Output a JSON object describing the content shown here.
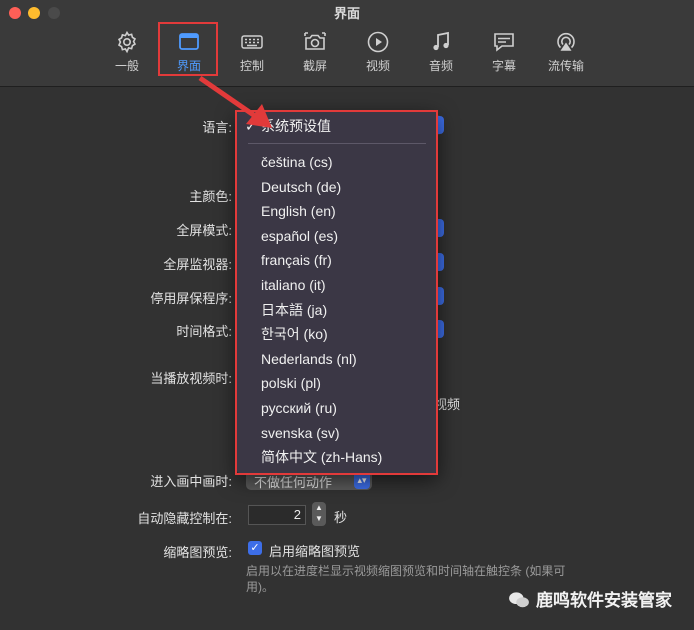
{
  "window": {
    "title": "界面"
  },
  "toolbar": {
    "items": [
      {
        "label": "一般",
        "icon": "gear-icon"
      },
      {
        "label": "界面",
        "icon": "window-icon",
        "selected": true
      },
      {
        "label": "控制",
        "icon": "keyboard-icon"
      },
      {
        "label": "截屏",
        "icon": "camera-icon"
      },
      {
        "label": "视频",
        "icon": "play-icon"
      },
      {
        "label": "音频",
        "icon": "music-note-icon"
      },
      {
        "label": "字幕",
        "icon": "subtitle-icon"
      },
      {
        "label": "流传输",
        "icon": "airplay-icon"
      }
    ]
  },
  "form": {
    "language_label": "语言:",
    "theme_color_label": "主颜色:",
    "fullscreen_mode_label": "全屏模式:",
    "fullscreen_monitor_label": "全屏监视器:",
    "disable_screensaver_label": "停用屏保程序:",
    "time_format_label": "时间格式:",
    "when_playing_label": "当播放视频时:",
    "when_playing_partial": "视频",
    "pip_label": "进入画中画时:",
    "pip_value": "不做任何动作",
    "autohide_label": "自动隐藏控制在:",
    "autohide_value": "2",
    "autohide_unit": "秒",
    "thumbnail_label": "缩略图预览:",
    "thumbnail_checkbox_label": "启用缩略图预览",
    "thumbnail_checked": true,
    "thumbnail_hint": "启用以在进度栏显示视频缩图预览和时间轴在触控条 (如果可用)。"
  },
  "language_menu": {
    "selected": "系统预设值",
    "options": [
      "čeština (cs)",
      "Deutsch (de)",
      "English (en)",
      "español (es)",
      "français (fr)",
      "italiano (it)",
      "日本語 (ja)",
      "한국어 (ko)",
      "Nederlands (nl)",
      "polski (pl)",
      "русский (ru)",
      "svenska (sv)",
      "简体中文 (zh-Hans)"
    ]
  },
  "footer": {
    "brand": "鹿鸣软件安装管家"
  },
  "colors": {
    "accent": "#3d6ee8",
    "highlight_border": "#e23a3a",
    "selected_tab": "#4f9bff"
  }
}
